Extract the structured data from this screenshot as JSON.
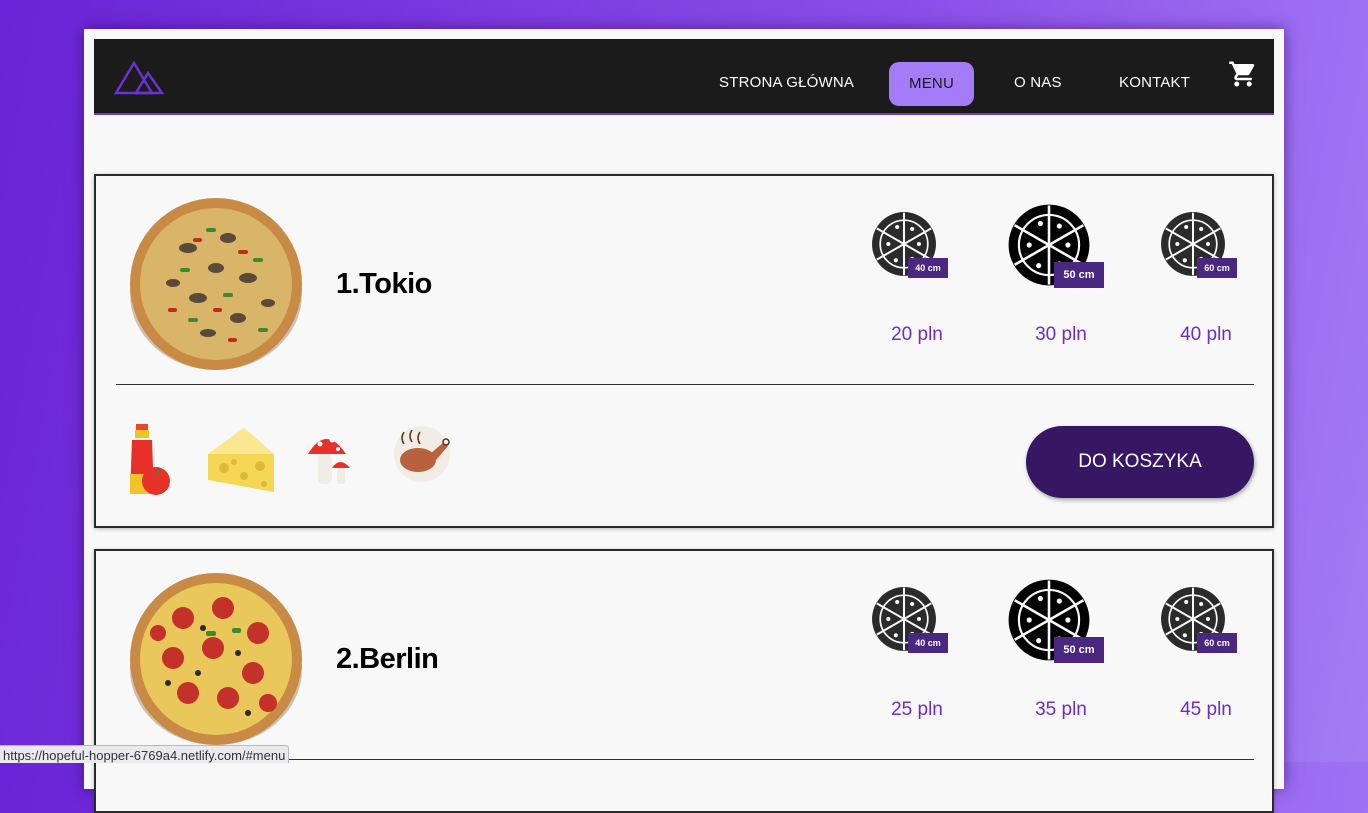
{
  "navbar": {
    "links": [
      "STRONA GŁÓWNA",
      "MENU",
      "O NAS",
      "KONTAKT"
    ],
    "active": "MENU",
    "logo": "mountain-logo-icon",
    "cart_icon": "shopping-cart-icon"
  },
  "colors": {
    "background": "#7a38e0",
    "nav": "#1b1b1b",
    "accent": "#a57cf7",
    "price": "#6c2fc0",
    "button": "#371763",
    "badge": "#4a2780"
  },
  "pizzas": [
    {
      "name": "1.Tokio",
      "sizes": [
        {
          "badge": "40 cm",
          "price": "20 pln"
        },
        {
          "badge": "50 cm",
          "price": "30 pln"
        },
        {
          "badge": "60 cm",
          "price": "40 pln"
        }
      ],
      "ingredients": [
        "ketchup-tomato-icon",
        "cheese-icon",
        "mushroom-icon",
        "chicken-icon"
      ],
      "button": "DO KOSZYKA"
    },
    {
      "name": "2.Berlin",
      "sizes": [
        {
          "badge": "40 cm",
          "price": "25 pln"
        },
        {
          "badge": "50 cm",
          "price": "35 pln"
        },
        {
          "badge": "60 cm",
          "price": "45 pln"
        }
      ]
    }
  ],
  "status_url": "https://hopeful-hopper-6769a4.netlify.com/#menu"
}
